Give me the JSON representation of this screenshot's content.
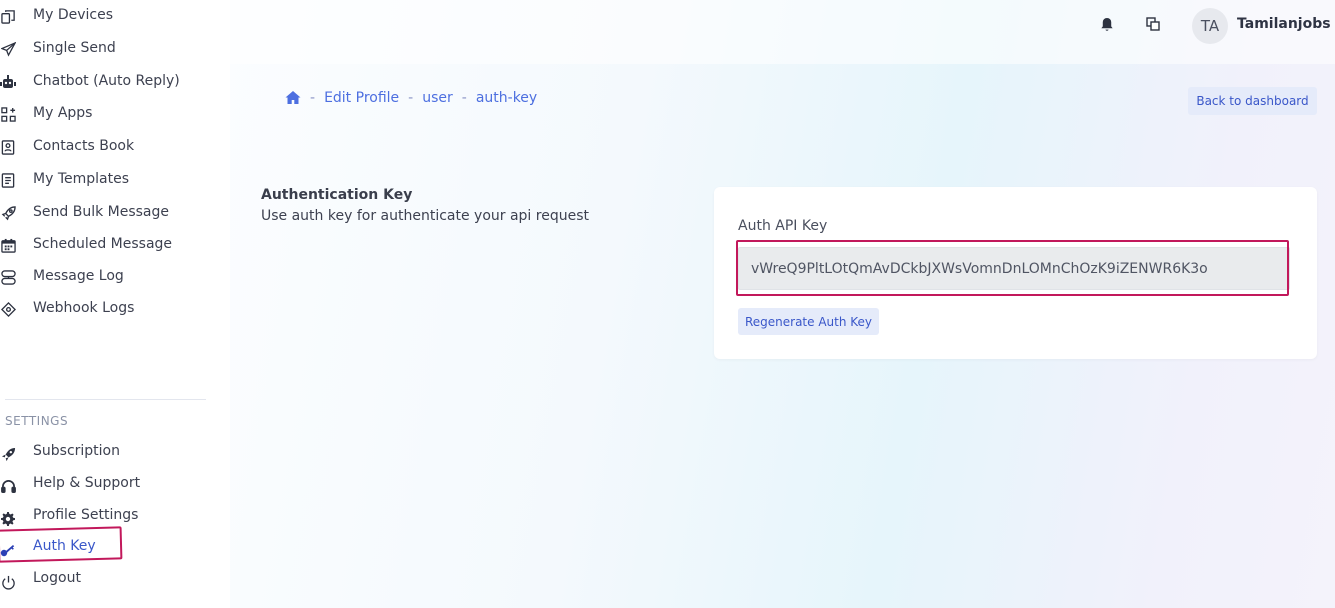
{
  "sidebar": {
    "items": [
      {
        "label": "My Devices",
        "icon": "devices-icon"
      },
      {
        "label": "Single Send",
        "icon": "send-icon"
      },
      {
        "label": "Chatbot (Auto Reply)",
        "icon": "robot-icon"
      },
      {
        "label": "My Apps",
        "icon": "apps-icon"
      },
      {
        "label": "Contacts Book",
        "icon": "contacts-book-icon"
      },
      {
        "label": "My Templates",
        "icon": "template-icon"
      },
      {
        "label": "Send Bulk Message",
        "icon": "rocket-icon"
      },
      {
        "label": "Scheduled Message",
        "icon": "calendar-icon"
      },
      {
        "label": "Message Log",
        "icon": "message-log-icon"
      },
      {
        "label": "Webhook Logs",
        "icon": "webhook-icon"
      }
    ],
    "settings_title": "SETTINGS",
    "settings_items": [
      {
        "label": "Subscription",
        "icon": "rocket-icon"
      },
      {
        "label": "Help & Support",
        "icon": "headset-icon"
      },
      {
        "label": "Profile Settings",
        "icon": "gear-icon"
      },
      {
        "label": "Auth Key",
        "icon": "key-icon",
        "active": true
      },
      {
        "label": "Logout",
        "icon": "power-icon"
      }
    ]
  },
  "header": {
    "avatar_initials": "TA",
    "username": "Tamilanjobs",
    "icons": [
      "bell-icon",
      "windows-icon"
    ]
  },
  "breadcrumb": {
    "items": [
      "Edit Profile",
      "user",
      "auth-key"
    ],
    "separator": "-"
  },
  "back_button": "Back to dashboard",
  "section": {
    "title": "Authentication Key",
    "description": "Use auth key for authenticate your api request"
  },
  "card": {
    "field_label": "Auth API Key",
    "auth_key_value": "vWreQ9PltLOtQmAvDCkbJXWsVomnDnLOMnChOzK9iZENWR6K3o",
    "regenerate_label": "Regenerate Auth Key"
  },
  "colors": {
    "accent": "#3a57c9",
    "highlight": "#c2185b",
    "button_bg": "#e5ebfa"
  }
}
